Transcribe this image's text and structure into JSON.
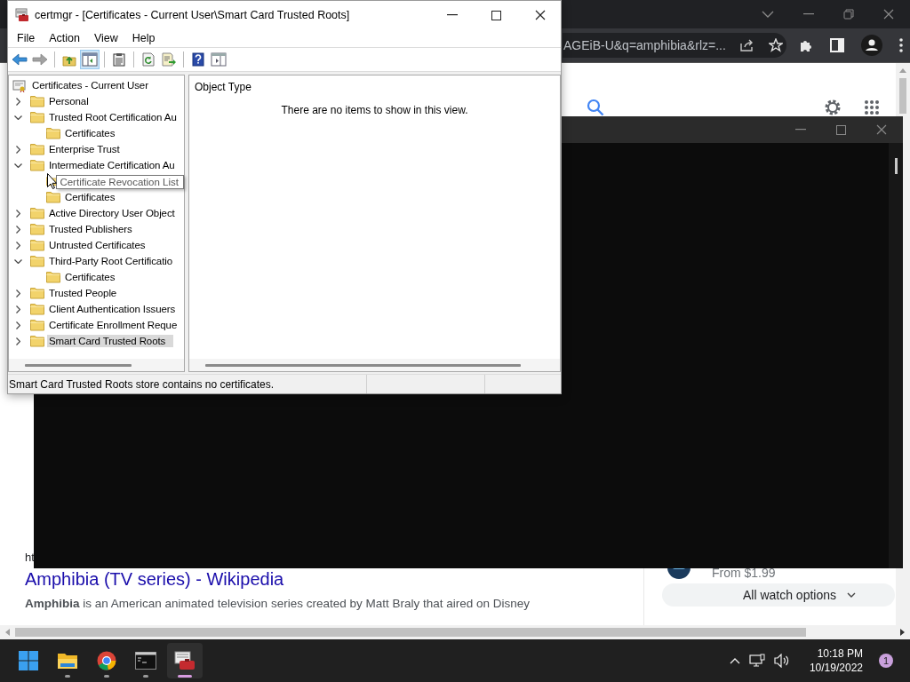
{
  "browser": {
    "address": "AGEiB-U&q=amphibia&rlz=...",
    "result": {
      "url": "ht",
      "title": "Amphibia (TV series) - Wikipedia",
      "snippet": "**Amphibia** is an American animated television series created by Matt Braly that aired on Disney"
    },
    "watch": {
      "price": "From $1.99",
      "button": "All watch options"
    }
  },
  "certmgr": {
    "title": "certmgr - [Certificates - Current User\\Smart Card Trusted Roots]",
    "menu": [
      "File",
      "Action",
      "View",
      "Help"
    ],
    "toolbar": [
      [
        {
          "kind": "back",
          "disabled": false,
          "pressed": false
        },
        {
          "kind": "forward",
          "disabled": true,
          "pressed": false
        }
      ],
      [
        {
          "kind": "up",
          "disabled": false,
          "pressed": false
        },
        {
          "kind": "tree",
          "disabled": false,
          "pressed": true
        }
      ],
      [
        {
          "kind": "properties",
          "disabled": false,
          "pressed": false
        }
      ],
      [
        {
          "kind": "refresh",
          "disabled": false,
          "pressed": false
        },
        {
          "kind": "export",
          "disabled": false,
          "pressed": false
        }
      ],
      [
        {
          "kind": "help",
          "disabled": false,
          "pressed": false
        },
        {
          "kind": "pane",
          "disabled": false,
          "pressed": false
        }
      ]
    ],
    "tree": {
      "label": "Certificates - Current User",
      "children": [
        {
          "label": "Personal",
          "expanded": false,
          "selected": false
        },
        {
          "label": "Trusted Root Certification Au",
          "expanded": true,
          "selected": false,
          "children": [
            {
              "label": "Certificates",
              "selected": false
            }
          ]
        },
        {
          "label": "Enterprise Trust",
          "expanded": false,
          "selected": false
        },
        {
          "label": "Intermediate Certification Au",
          "expanded": true,
          "selected": false,
          "children": [
            {
              "label": "Certificate Revocation List",
              "selected": false,
              "tooltip": true
            },
            {
              "label": "Certificates",
              "selected": false
            }
          ]
        },
        {
          "label": "Active Directory User Object",
          "expanded": false,
          "selected": false
        },
        {
          "label": "Trusted Publishers",
          "expanded": false,
          "selected": false
        },
        {
          "label": "Untrusted Certificates",
          "expanded": false,
          "selected": false
        },
        {
          "label": "Third-Party Root Certificatio",
          "expanded": true,
          "selected": false,
          "children": [
            {
              "label": "Certificates",
              "selected": false
            }
          ]
        },
        {
          "label": "Trusted People",
          "expanded": false,
          "selected": false
        },
        {
          "label": "Client Authentication Issuers",
          "expanded": false,
          "selected": false
        },
        {
          "label": "Certificate Enrollment Reque",
          "expanded": false,
          "selected": false
        },
        {
          "label": "Smart Card Trusted Roots",
          "expanded": false,
          "selected": true
        }
      ]
    },
    "list": {
      "column": "Object Type",
      "message": "There are no items to show in this view."
    },
    "status_bar": {
      "text": "Smart Card Trusted Roots store contains no certificates."
    }
  },
  "taskbar": {
    "apps": [
      {
        "kind": "start",
        "active": false
      },
      {
        "kind": "explorer",
        "active": false
      },
      {
        "kind": "chrome",
        "active": false
      },
      {
        "kind": "terminal",
        "active": false
      },
      {
        "kind": "certmgr",
        "active": true
      }
    ],
    "time": "10:18 PM",
    "date": "10/19/2022",
    "notifications": "1"
  }
}
